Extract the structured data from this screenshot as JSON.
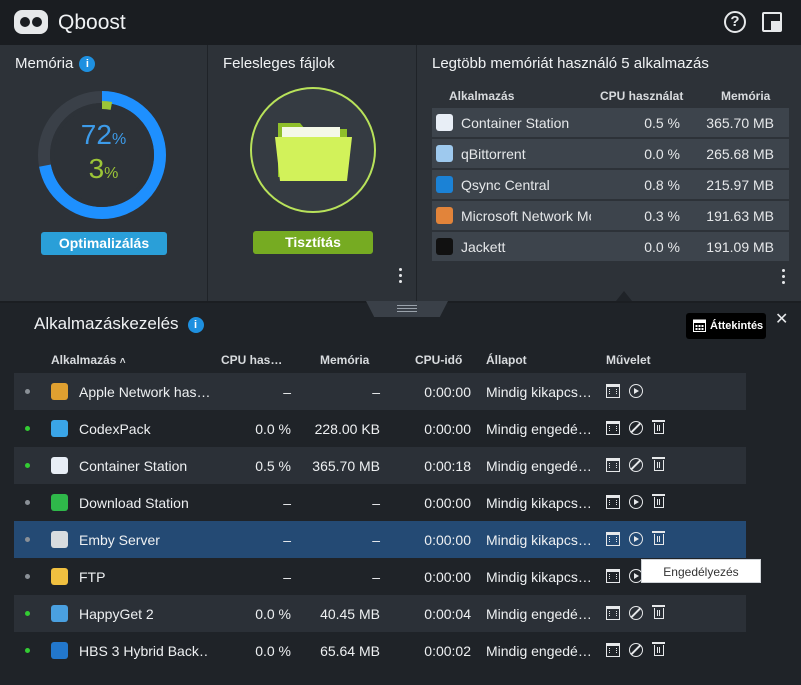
{
  "app": {
    "title": "Qboost"
  },
  "memory_panel": {
    "title": "Memória",
    "memory_percent": "72",
    "cpu_percent": "3",
    "percent_sign": "%",
    "button": "Optimalizálás",
    "memory_level": 0.72,
    "cpu_level": 0.03
  },
  "junk_panel": {
    "title": "Felesleges fájlok",
    "button": "Tisztítás"
  },
  "top_panel": {
    "title": "Legtöbb memóriát használó 5 alkalmazás",
    "headers": {
      "app": "Alkalmazás",
      "cpu": "CPU használat",
      "mem": "Memória"
    },
    "rows": [
      {
        "name": "Container Station",
        "cpu": "0.5 %",
        "mem": "365.70 MB",
        "icon": "container-station-icon",
        "color": "#e8eef6"
      },
      {
        "name": "qBittorrent",
        "cpu": "0.0 %",
        "mem": "265.68 MB",
        "icon": "qbittorrent-icon",
        "color": "#9ec9ee"
      },
      {
        "name": "Qsync Central",
        "cpu": "0.8 %",
        "mem": "215.97 MB",
        "icon": "qsync-icon",
        "color": "#1b82d6"
      },
      {
        "name": "Microsoft Network Monitor",
        "cpu": "0.3 %",
        "mem": "191.63 MB",
        "icon": "network-triangle-icon",
        "color": "#e2843a"
      },
      {
        "name": "Jackett",
        "cpu": "0.0 %",
        "mem": "191.09 MB",
        "icon": "jackett-icon",
        "color": "#111111"
      }
    ]
  },
  "manager": {
    "title": "Alkalmazáskezelés",
    "overview_button": "Áttekintés",
    "sort_indicator": "˄",
    "headers": {
      "app": "Alkalmazás",
      "cpu": "CPU has…",
      "mem": "Memória",
      "time": "CPU-idő",
      "state": "Állapot",
      "action": "Művelet"
    },
    "rows": [
      {
        "name": "Apple Network has…",
        "cpu": "–",
        "mem": "–",
        "time": "0:00:00",
        "state": "Mindig kikapcs…",
        "status_color": "#8a9097",
        "icon": "apple-network-icon",
        "icon_color": "#e0a030",
        "actions": [
          "calendar-icon",
          "play-icon"
        ]
      },
      {
        "name": "CodexPack",
        "cpu": "0.0 %",
        "mem": "228.00 KB",
        "time": "0:00:00",
        "state": "Mindig engedé…",
        "status_color": "#33cc33",
        "icon": "codexpack-icon",
        "icon_color": "#3aa5e8",
        "actions": [
          "calendar-icon",
          "disable-icon",
          "trash-icon"
        ]
      },
      {
        "name": "Container Station",
        "cpu": "0.5 %",
        "mem": "365.70 MB",
        "time": "0:00:18",
        "state": "Mindig engedé…",
        "status_color": "#33cc33",
        "icon": "container-station-icon",
        "icon_color": "#e8eef6",
        "actions": [
          "calendar-icon",
          "disable-icon",
          "trash-icon"
        ]
      },
      {
        "name": "Download Station",
        "cpu": "–",
        "mem": "–",
        "time": "0:00:00",
        "state": "Mindig kikapcs…",
        "status_color": "#8a9097",
        "icon": "download-station-icon",
        "icon_color": "#2fb84a",
        "actions": [
          "calendar-icon",
          "play-icon",
          "trash-icon"
        ]
      },
      {
        "name": "Emby Server",
        "cpu": "–",
        "mem": "–",
        "time": "0:00:00",
        "state": "Mindig kikapcs…",
        "status_color": "#8a9097",
        "icon": "emby-icon",
        "icon_color": "#d8dcdf",
        "actions": [
          "calendar-icon",
          "play-icon",
          "trash-icon"
        ]
      },
      {
        "name": "FTP",
        "cpu": "–",
        "mem": "–",
        "time": "0:00:00",
        "state": "Mindig kikapcs…",
        "status_color": "#8a9097",
        "icon": "ftp-icon",
        "icon_color": "#f0c040",
        "actions": [
          "calendar-icon",
          "play-icon"
        ]
      },
      {
        "name": "HappyGet 2",
        "cpu": "0.0 %",
        "mem": "40.45 MB",
        "time": "0:00:04",
        "state": "Mindig engedé…",
        "status_color": "#33cc33",
        "icon": "happyget-icon",
        "icon_color": "#4aa0e0",
        "actions": [
          "calendar-icon",
          "disable-icon",
          "trash-icon"
        ]
      },
      {
        "name": "HBS 3 Hybrid Back…",
        "cpu": "0.0 %",
        "mem": "65.64 MB",
        "time": "0:00:02",
        "state": "Mindig engedé…",
        "status_color": "#33cc33",
        "icon": "hbs-icon",
        "icon_color": "#2277cc",
        "actions": [
          "calendar-icon",
          "disable-icon",
          "trash-icon"
        ]
      }
    ]
  },
  "tooltip": {
    "text": "Engedélyezés"
  },
  "colors": {
    "memory": "#1e90ff",
    "cpu": "#9cc537",
    "selected_row": "#244a74"
  }
}
